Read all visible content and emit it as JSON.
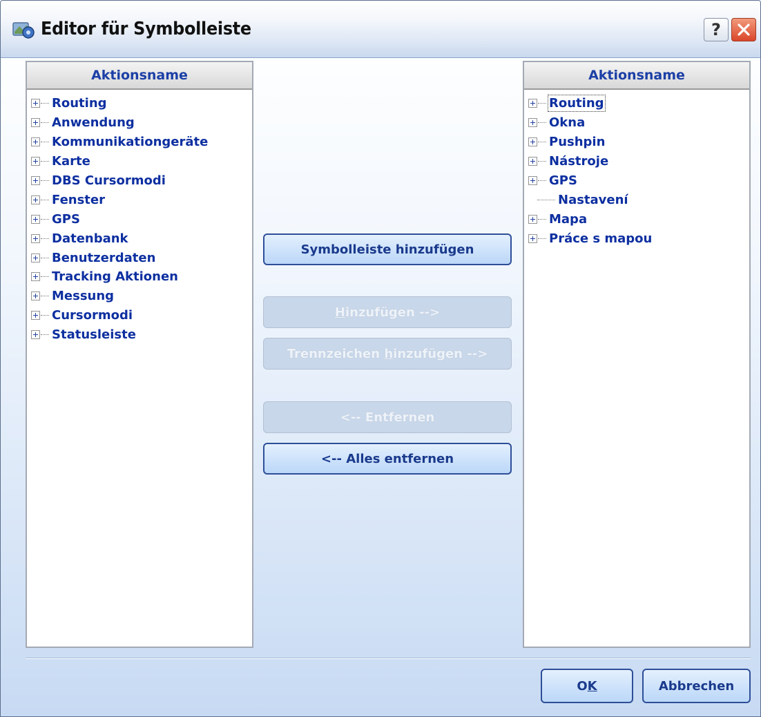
{
  "window": {
    "title": "Editor für Symbolleiste",
    "help_label": "?"
  },
  "left_panel": {
    "header": "Aktionsname",
    "items": [
      {
        "label": "Routing"
      },
      {
        "label": "Anwendung"
      },
      {
        "label": "Kommunikationgeräte"
      },
      {
        "label": "Karte"
      },
      {
        "label": "DBS Cursormodi"
      },
      {
        "label": "Fenster"
      },
      {
        "label": "GPS"
      },
      {
        "label": "Datenbank"
      },
      {
        "label": "Benutzerdaten"
      },
      {
        "label": "Tracking Aktionen"
      },
      {
        "label": "Messung"
      },
      {
        "label": "Cursormodi"
      },
      {
        "label": "Statusleiste"
      }
    ]
  },
  "right_panel": {
    "header": "Aktionsname",
    "items": [
      {
        "label": "Routing",
        "expandable": true,
        "focused": true
      },
      {
        "label": "Okna",
        "expandable": true
      },
      {
        "label": "Pushpin",
        "expandable": true
      },
      {
        "label": "Nástroje",
        "expandable": true
      },
      {
        "label": "GPS",
        "expandable": true
      },
      {
        "label": "Nastavení",
        "expandable": false
      },
      {
        "label": "Mapa",
        "expandable": true
      },
      {
        "label": "Práce s mapou",
        "expandable": true
      }
    ]
  },
  "buttons": {
    "add_toolbar": "Symbolleiste hinzufügen",
    "add": {
      "prefix": "",
      "mnemonic": "H",
      "suffix": "inzufügen -->",
      "enabled": false
    },
    "add_separator": {
      "prefix": "Trennzeichen ",
      "mnemonic": "h",
      "suffix": "inzufügen -->",
      "enabled": false
    },
    "remove": {
      "label": "<-- Entfernen",
      "enabled": false
    },
    "remove_all": "<-- Alles entfernen",
    "ok": {
      "prefix": "O",
      "mnemonic": "K",
      "suffix": ""
    },
    "cancel": "Abbrechen"
  },
  "colors": {
    "accent_text": "#0d2fa0",
    "button_border": "#2d4e98",
    "close_button": "#d9462a"
  }
}
